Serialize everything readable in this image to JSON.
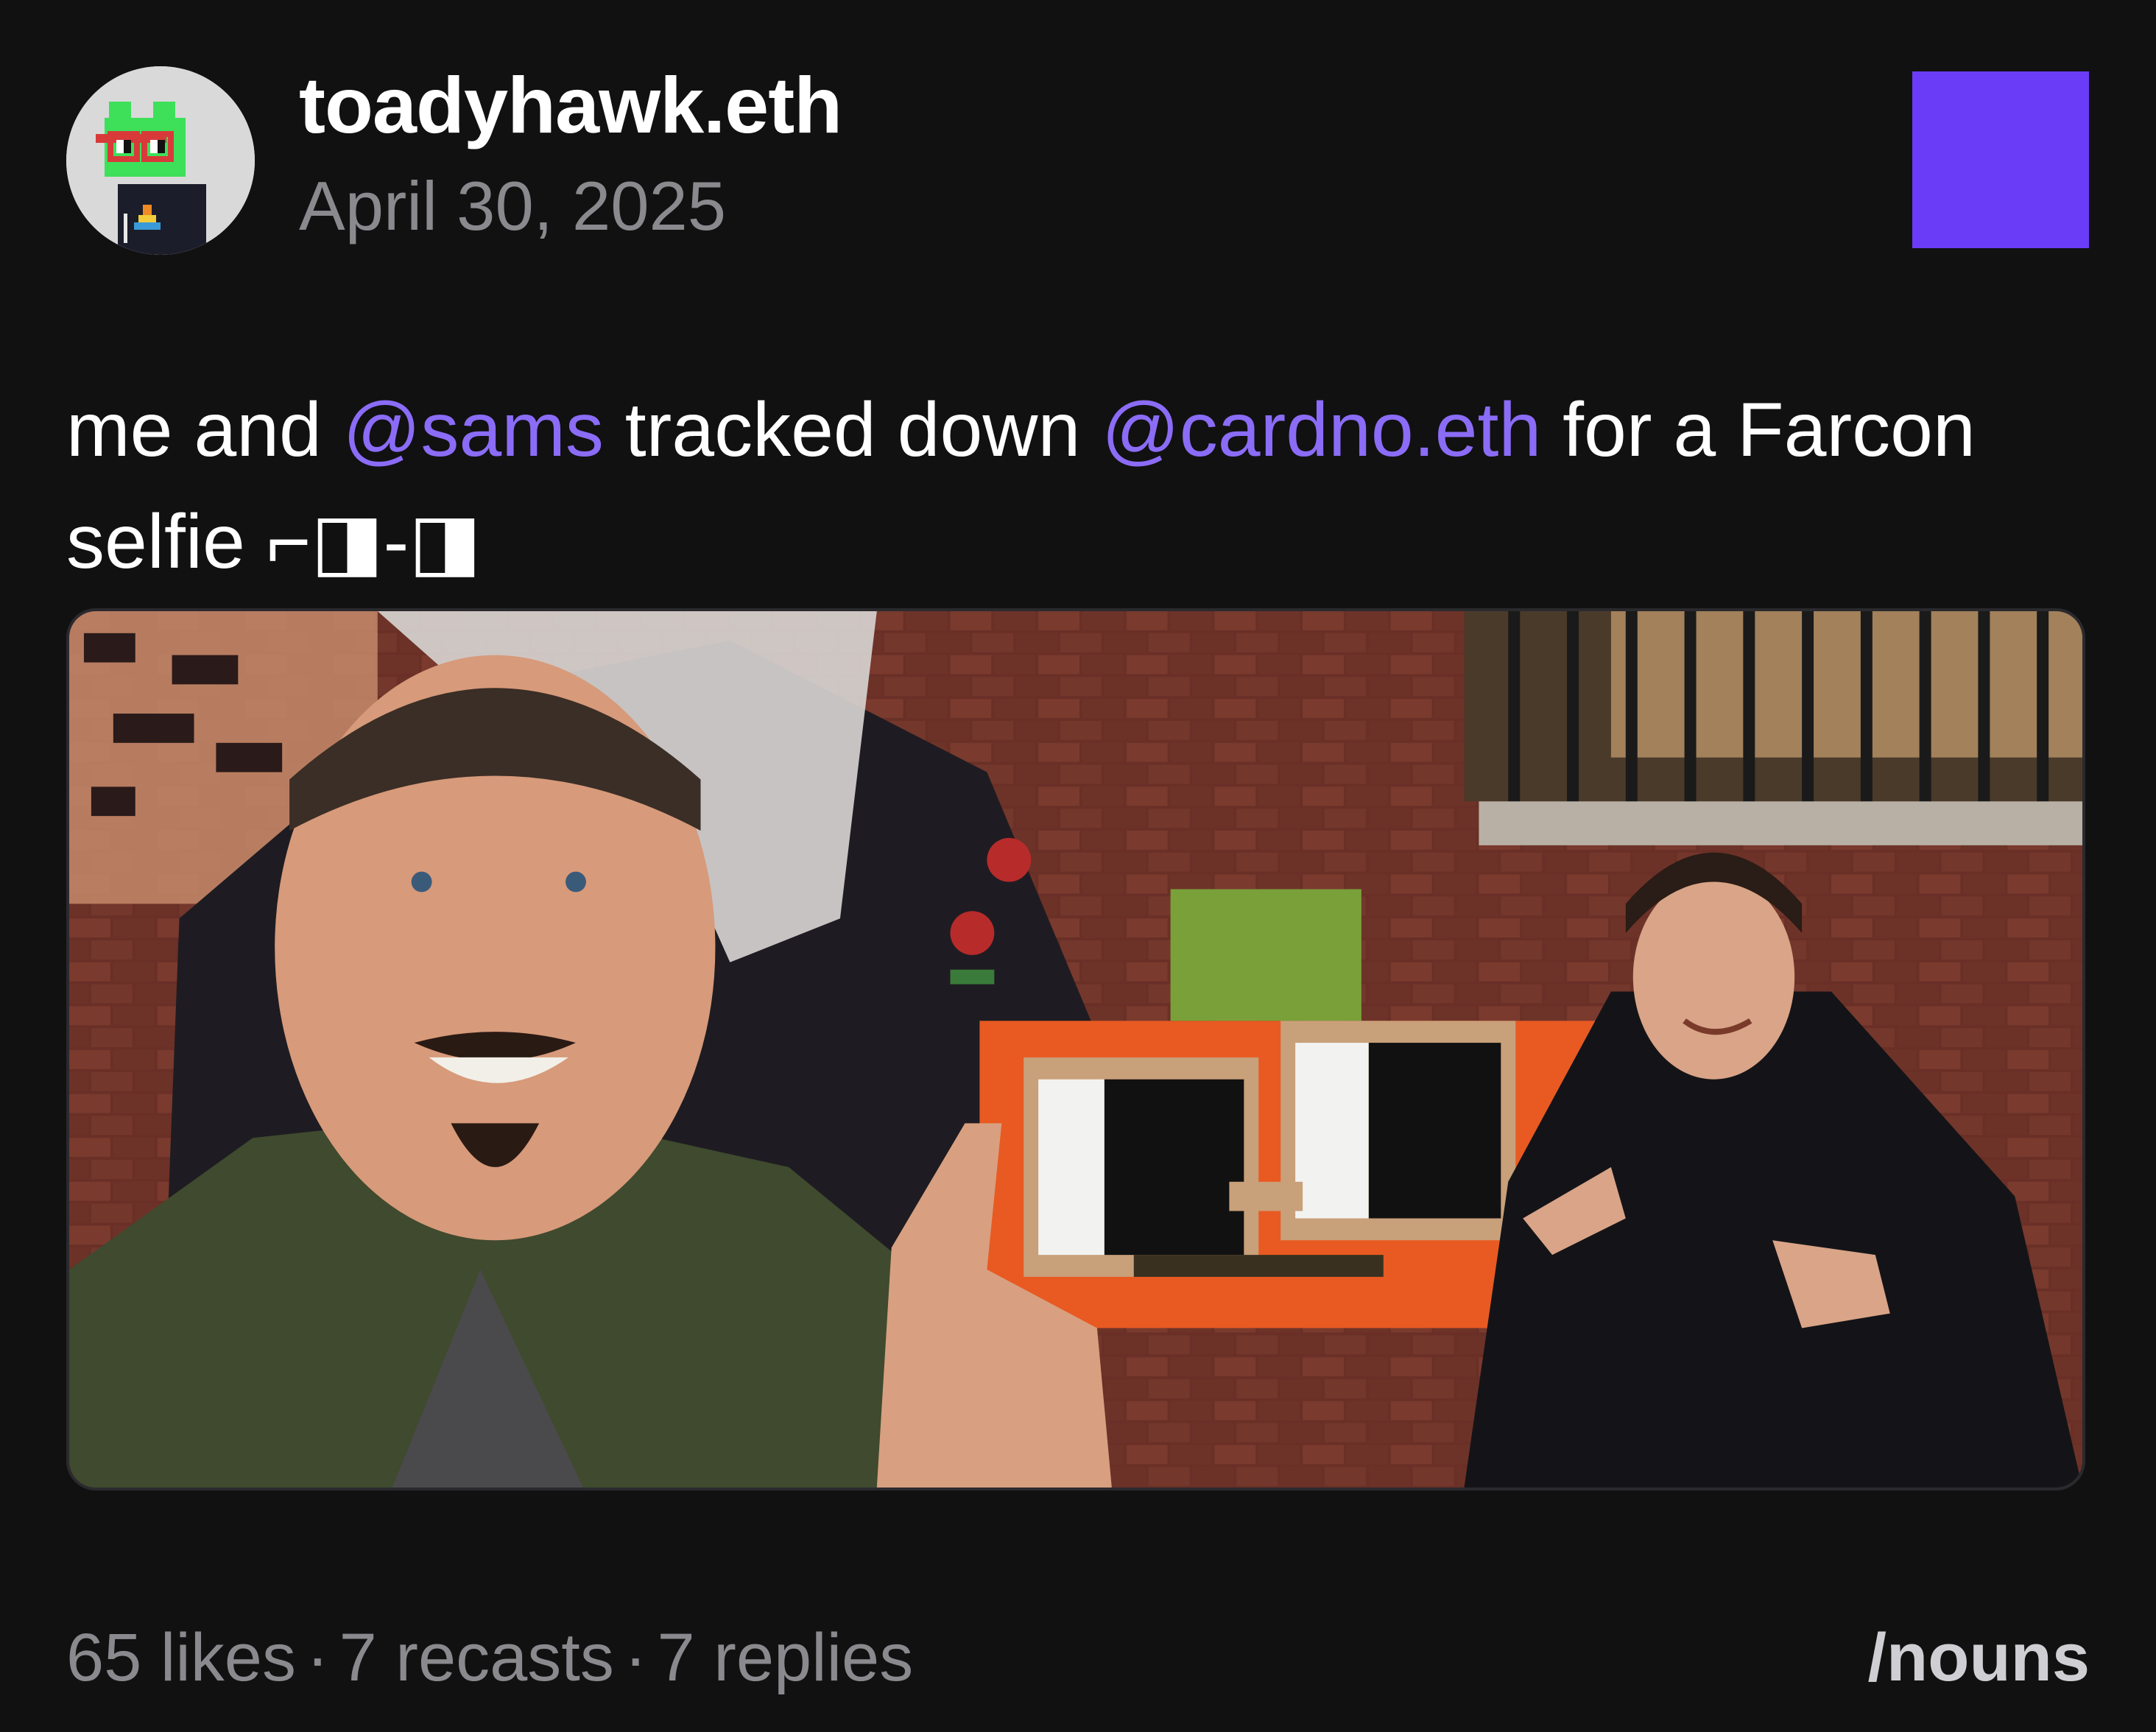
{
  "post": {
    "author": "toadyhawk.eth",
    "date": "April 30, 2025",
    "text_parts": {
      "t1": "me and ",
      "mention1": "@sams",
      "t2": " tracked down ",
      "mention2": "@cardno.eth",
      "t3": " for a Farcon selfie ⌐◨-◨"
    },
    "image_icon": "photo-selfie",
    "stats": {
      "likes": "65 likes",
      "recasts": "7 recasts",
      "replies": "7 replies",
      "separator": "·"
    },
    "channel": "/nouns"
  },
  "colors": {
    "background": "#111112",
    "mention": "#8b6cf6",
    "badge": "#6b3cf7",
    "muted": "#8a8a8e"
  }
}
